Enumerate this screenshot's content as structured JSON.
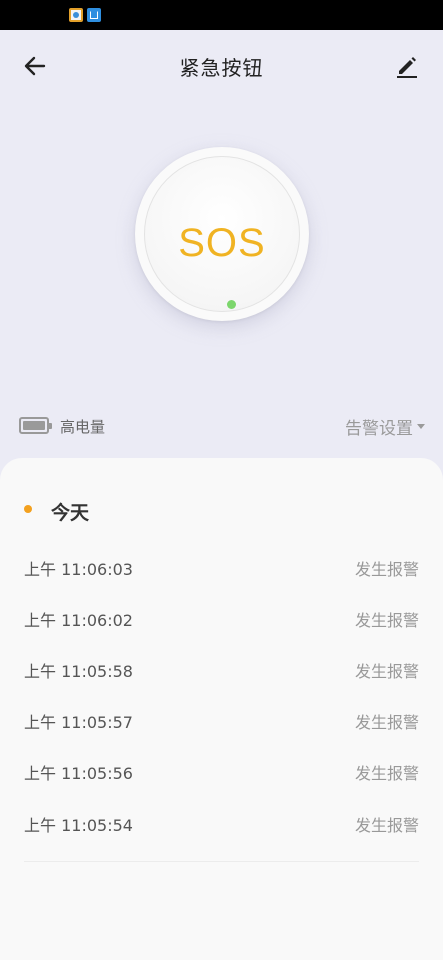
{
  "header": {
    "title": "紧急按钮"
  },
  "sos": {
    "label": "SOS"
  },
  "battery": {
    "label": "高电量"
  },
  "alarm_settings": {
    "label": "告警设置"
  },
  "history": {
    "day_label": "今天",
    "entries": [
      {
        "time": "上午  11:06:03",
        "status": "发生报警"
      },
      {
        "time": "上午  11:06:02",
        "status": "发生报警"
      },
      {
        "time": "上午  11:05:58",
        "status": "发生报警"
      },
      {
        "time": "上午  11:05:57",
        "status": "发生报警"
      },
      {
        "time": "上午  11:05:56",
        "status": "发生报警"
      },
      {
        "time": "上午  11:05:54",
        "status": "发生报警"
      }
    ]
  },
  "colors": {
    "background": "#ebebf5",
    "sos_text": "#f0b323",
    "led": "#7cd66c",
    "today_dot": "#f3a11f",
    "panel": "#f9f9f9"
  },
  "icons": [
    "back-arrow-icon",
    "edit-pencil-icon",
    "battery-icon",
    "caret-down-icon"
  ]
}
